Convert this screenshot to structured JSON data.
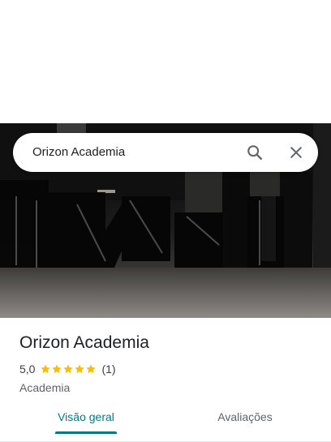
{
  "search": {
    "query": "Orizon Academia"
  },
  "icons": {
    "search": "search-icon",
    "close": "close-icon",
    "star": "star-icon"
  },
  "place": {
    "name": "Orizon Academia",
    "rating": "5,0",
    "stars": 5,
    "review_count": "(1)",
    "category": "Academia"
  },
  "tabs": [
    {
      "label": "Visão geral",
      "active": true
    },
    {
      "label": "Avaliações",
      "active": false
    }
  ],
  "colors": {
    "accent": "#007b83",
    "star": "#fbbc04",
    "text": "#202124"
  }
}
